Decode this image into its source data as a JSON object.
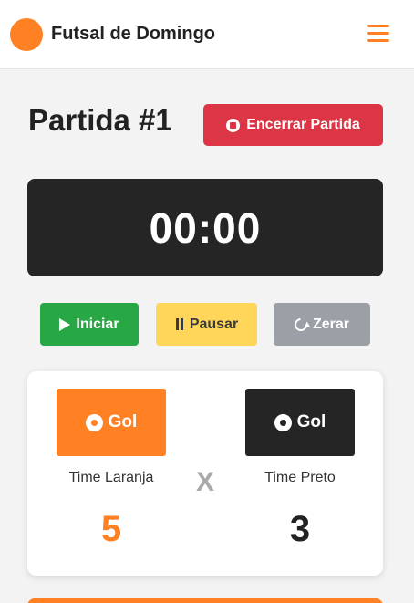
{
  "app": {
    "name": "Futsal de Domingo"
  },
  "match": {
    "title": "Partida #1",
    "end_label": "Encerrar Partida",
    "timer": "00:00"
  },
  "controls": {
    "start_label": "Iniciar",
    "pause_label": "Pausar",
    "reset_label": "Zerar"
  },
  "scoreboard": {
    "separator": "X",
    "teams": [
      {
        "name": "Time Laranja",
        "goal_label": "Gol",
        "score": "5",
        "color": "#ff8124"
      },
      {
        "name": "Time Preto",
        "goal_label": "Gol",
        "score": "3",
        "color": "#252525"
      }
    ]
  },
  "colors": {
    "brand": "#ff8124",
    "danger": "#dc3545",
    "success": "#28a745",
    "warning": "#ffd65a",
    "secondary": "#9aa0a6",
    "dark": "#252525"
  },
  "icons": [
    "logo-circle-icon",
    "hamburger-menu-icon",
    "stop-circle-icon",
    "play-icon",
    "pause-icon",
    "redo-icon",
    "soccer-ball-icon"
  ]
}
